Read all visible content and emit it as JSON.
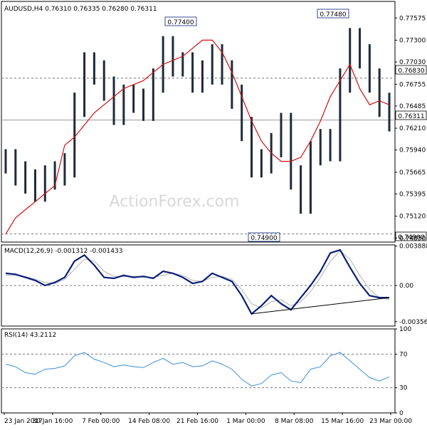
{
  "colors": {
    "background": "#ffffff",
    "candle": "#1f2a3a",
    "ma": "#d01010",
    "macd": "#0b1f7a",
    "signal": "#b0b0b0",
    "rsi": "#3b8fd6",
    "axis": "#000000",
    "dotted": "#777777",
    "watermark": "#d8d8d8"
  },
  "watermark": "ActionForex.com",
  "chart_data": [
    {
      "type": "line",
      "panel": "price",
      "title": "AUDUSD,H4 0.76310 0.76335 0.76280 0.76311",
      "ylim": [
        0.748,
        0.7778
      ],
      "y_ticks": [
        "0.77575",
        "0.77300",
        "0.77030",
        "0.76755",
        "0.76485",
        "0.76210",
        "0.75940",
        "0.75665",
        "0.75395",
        "0.75120",
        "0.74850"
      ],
      "labels": {
        "level_hi1": "0.77400",
        "level_hi2": "0.77480",
        "level_lo": "0.74900",
        "level_dash": "0.76830",
        "last": "0.76311",
        "right_lo": "0.74900"
      },
      "levels": {
        "dash": 0.7683,
        "last": 0.76311,
        "low_marker": 0.749
      },
      "series": [
        {
          "values": [
            0.758,
            0.7565,
            0.7555,
            0.7545,
            0.756,
            0.7565,
            0.7575,
            0.765,
            0.77,
            0.769,
            0.767,
            0.764,
            0.766,
            0.7655,
            0.7645,
            0.768,
            0.772,
            0.77,
            0.77,
            0.768,
            0.769,
            0.771,
            0.769,
            0.766,
            0.762,
            0.7575,
            0.758,
            0.76,
            0.7625,
            0.756,
            0.753,
            0.759,
            0.7605,
            0.7595,
            0.768,
            0.773,
            0.771,
            0.768,
            0.765,
            0.7632
          ]
        }
      ],
      "ma_values": [
        0.749,
        0.751,
        0.752,
        0.753,
        0.754,
        0.755,
        0.76,
        0.761,
        0.7625,
        0.764,
        0.765,
        0.766,
        0.767,
        0.7675,
        0.768,
        0.769,
        0.77,
        0.7705,
        0.771,
        0.772,
        0.773,
        0.773,
        0.7715,
        0.769,
        0.766,
        0.763,
        0.7605,
        0.759,
        0.758,
        0.758,
        0.7585,
        0.7605,
        0.763,
        0.766,
        0.768,
        0.77,
        0.767,
        0.765,
        0.7655,
        0.765
      ]
    },
    {
      "type": "line",
      "panel": "macd",
      "title": "MACD(12,26,9) -0.001312 -0.001433",
      "ylim": [
        -0.004,
        0.004
      ],
      "y_ticks": [
        "0.003888",
        "0.00",
        "-0.003564"
      ],
      "series": [
        {
          "name": "MACD",
          "values": [
            0.0012,
            0.0011,
            0.0008,
            0.0005,
            0.0,
            0.0003,
            0.0008,
            0.0024,
            0.003,
            0.002,
            0.0008,
            0.0007,
            0.001,
            0.0008,
            0.0009,
            0.0007,
            0.0014,
            0.0012,
            0.0008,
            0.0002,
            0.0004,
            0.0012,
            0.0008,
            0.0004,
            -0.001,
            -0.0028,
            -0.002,
            -0.001,
            -0.0018,
            -0.0024,
            -0.0012,
            0.0,
            0.0014,
            0.0032,
            0.0035,
            0.0018,
            0.0002,
            -0.001,
            -0.0012,
            -0.0012
          ]
        },
        {
          "name": "Signal",
          "values": [
            0.001,
            0.001,
            0.0009,
            0.0006,
            0.0003,
            0.0002,
            0.0006,
            0.0016,
            0.0026,
            0.0024,
            0.0014,
            0.0009,
            0.0009,
            0.0009,
            0.0008,
            0.0008,
            0.001,
            0.0012,
            0.001,
            0.0005,
            0.0004,
            0.0008,
            0.0009,
            0.0006,
            -0.0004,
            -0.0018,
            -0.0022,
            -0.0016,
            -0.0014,
            -0.002,
            -0.0016,
            -0.0006,
            0.0008,
            0.0024,
            0.0034,
            0.0026,
            0.001,
            -0.0004,
            -0.0012,
            -0.0014
          ]
        }
      ]
    },
    {
      "type": "line",
      "panel": "rsi",
      "title": "RSI(14) 43.2112",
      "ylim": [
        0,
        100
      ],
      "y_ticks": [
        "100",
        "70",
        "30",
        "0"
      ],
      "levels": [
        70,
        30
      ],
      "series": [
        {
          "name": "RSI",
          "values": [
            58,
            55,
            48,
            46,
            52,
            53,
            56,
            68,
            72,
            64,
            60,
            55,
            57,
            55,
            54,
            60,
            65,
            58,
            60,
            55,
            56,
            62,
            58,
            52,
            40,
            32,
            35,
            45,
            48,
            38,
            36,
            52,
            55,
            68,
            72,
            62,
            52,
            42,
            38,
            43
          ]
        }
      ]
    }
  ],
  "x_labels": [
    "23 Jan 2017",
    "30 Jan 16:00",
    "7 Feb 00:00",
    "14 Feb 08:00",
    "21 Feb 16:00",
    "1 Mar 00:00",
    "8 Mar 08:00",
    "15 Mar 16:00",
    "23 Mar 00:00"
  ]
}
